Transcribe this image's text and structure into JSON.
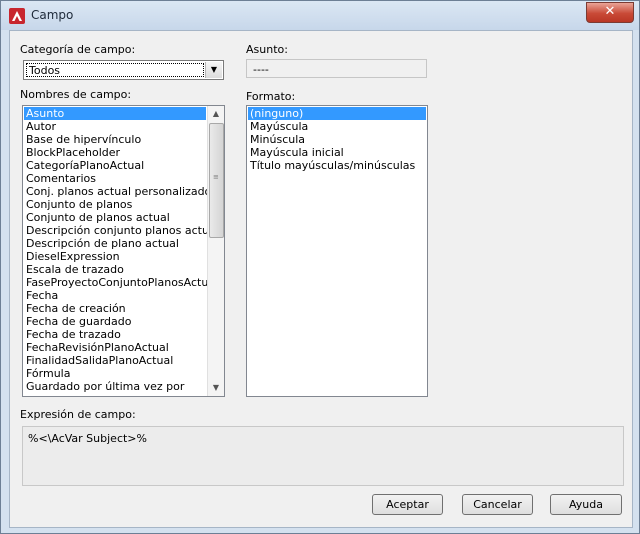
{
  "window": {
    "title": "Campo",
    "close_glyph": "✕"
  },
  "category": {
    "label": "Categoría de campo:",
    "value": "Todos"
  },
  "subject": {
    "label": "Asunto:",
    "value": "----"
  },
  "field_names": {
    "label": "Nombres de campo:",
    "selected_index": 0,
    "items": [
      "Asunto",
      "Autor",
      "Base de hipervínculo",
      "BlockPlaceholder",
      "CategoríaPlanoActual",
      "Comentarios",
      "Conj. planos actual personalizado",
      "Conjunto de planos",
      "Conjunto de planos actual",
      "Descripción conjunto planos actual",
      "Descripción de plano actual",
      "DieselExpression",
      "Escala de trazado",
      "FaseProyectoConjuntoPlanosActual",
      "Fecha",
      "Fecha de creación",
      "Fecha de guardado",
      "Fecha de trazado",
      "FechaRevisiónPlanoActual",
      "FinalidadSalidaPlanoActual",
      "Fórmula",
      "Guardado por última vez por"
    ]
  },
  "format": {
    "label": "Formato:",
    "selected_index": 0,
    "items": [
      "(ninguno)",
      "Mayúscula",
      "Minúscula",
      "Mayúscula inicial",
      "Título mayúsculas/minúsculas"
    ]
  },
  "expression": {
    "label": "Expresión de campo:",
    "value": "%<\\AcVar Subject>%"
  },
  "buttons": {
    "ok": "Aceptar",
    "cancel": "Cancelar",
    "help": "Ayuda"
  },
  "colors": {
    "selection": "#3399ff",
    "close": "#c94a37"
  }
}
